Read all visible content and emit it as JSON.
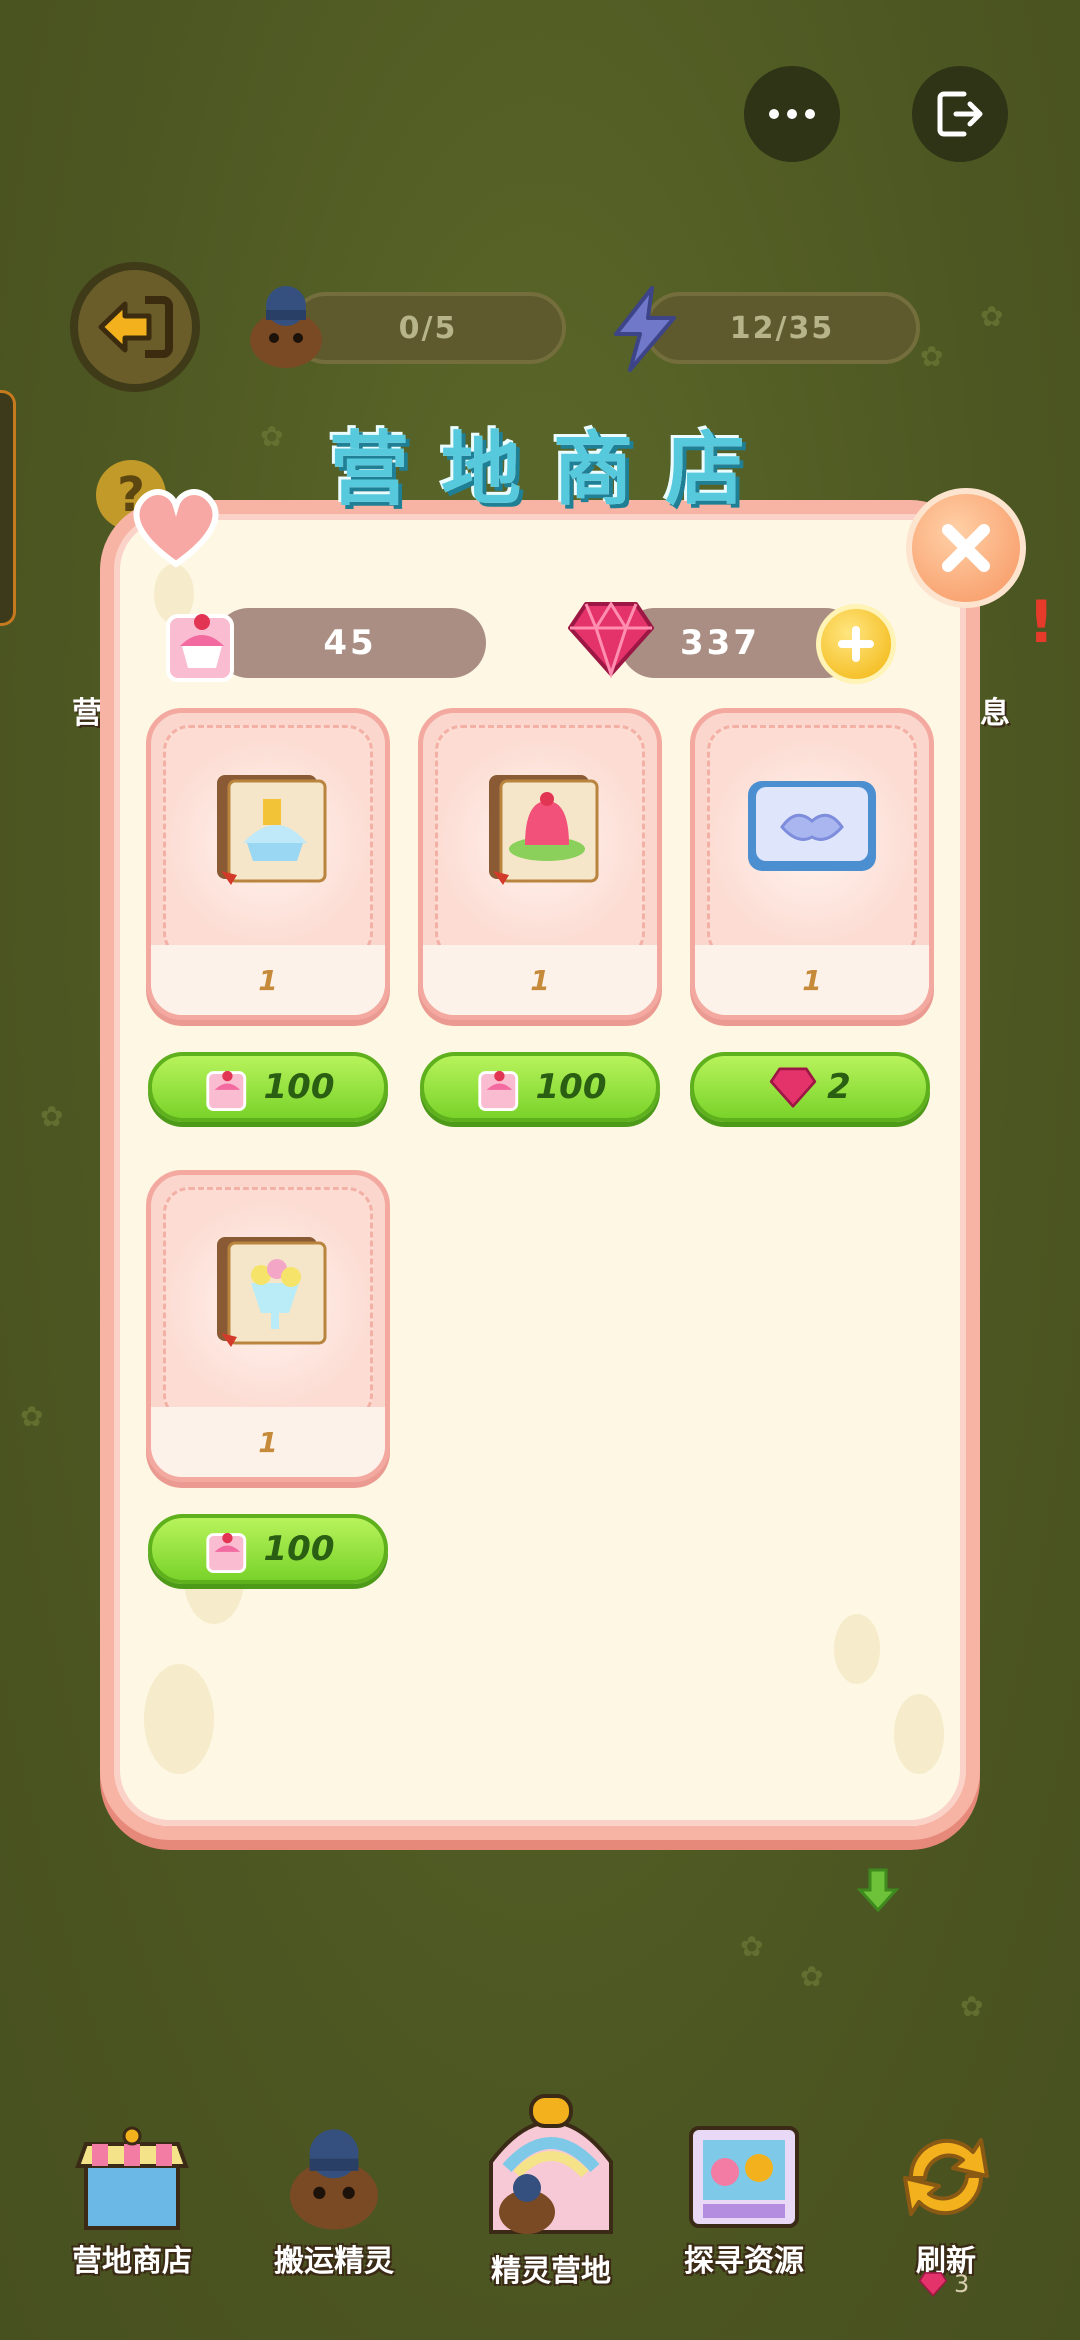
{
  "top_bar": {
    "more_icon": "ellipsis-icon",
    "exit_icon": "exit-icon"
  },
  "hud": {
    "workers": "0/5",
    "energy": "12/35"
  },
  "shop": {
    "title_chars": [
      "营",
      "地",
      "商",
      "店"
    ],
    "puzzle_currency": "45",
    "gem_currency": "337",
    "items": [
      {
        "name": "recipe-cake",
        "qty": "1",
        "price": "100",
        "currency": "puzzle"
      },
      {
        "name": "recipe-jelly",
        "qty": "1",
        "price": "100",
        "currency": "puzzle"
      },
      {
        "name": "handshake-card",
        "qty": "1",
        "price": "2",
        "currency": "gem"
      },
      {
        "name": "recipe-parfait",
        "qty": "1",
        "price": "100",
        "currency": "puzzle"
      }
    ]
  },
  "side_labels": {
    "left": "营",
    "right": "息"
  },
  "bottom_nav": [
    {
      "label": "营地商店"
    },
    {
      "label": "搬运精灵"
    },
    {
      "label": "精灵营地"
    },
    {
      "label": "探寻资源"
    },
    {
      "label": "刷新",
      "cost": "3"
    }
  ],
  "colors": {
    "panel_bg": "#fdf7e4",
    "buy_green": "#7ad32a",
    "title_blue": "#56c9dc"
  }
}
